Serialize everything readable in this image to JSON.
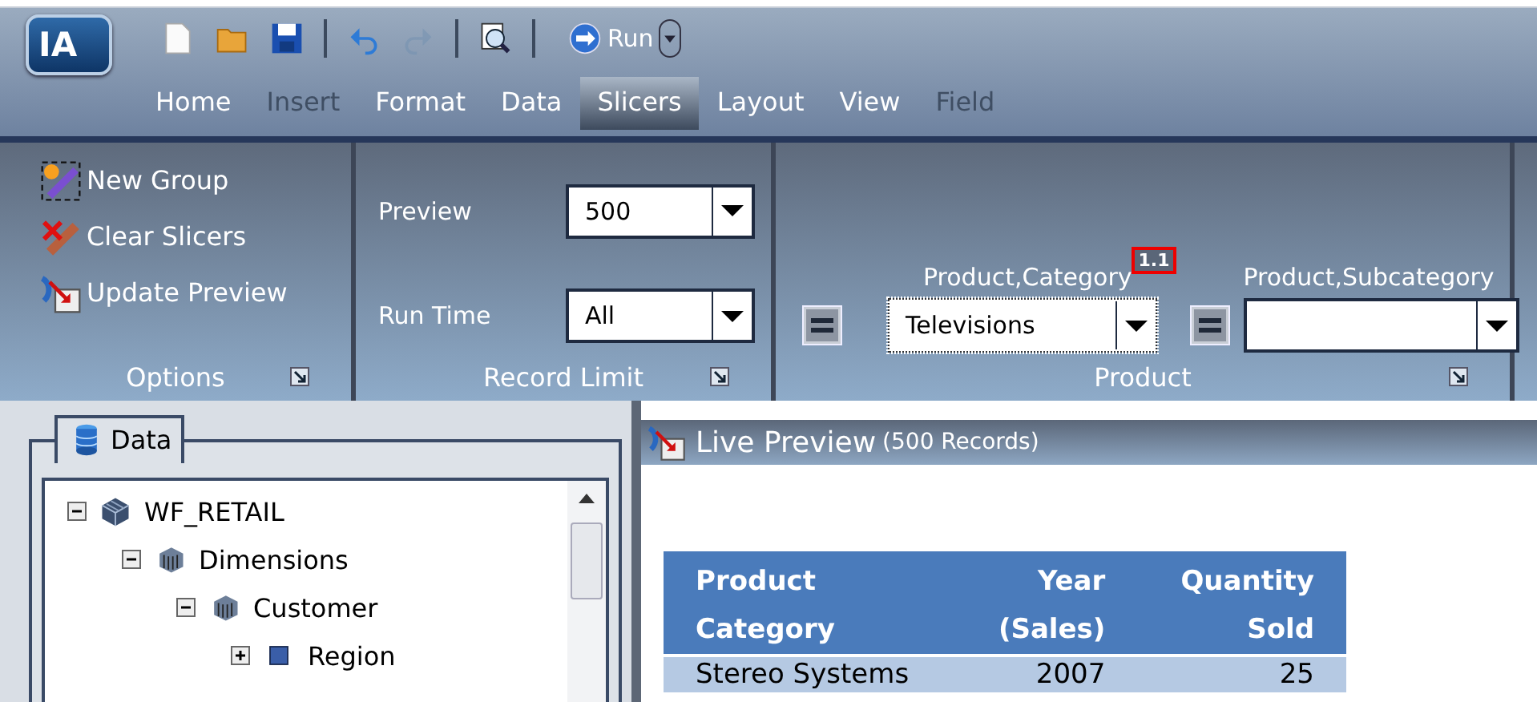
{
  "app": {
    "logo": "IA"
  },
  "quick_access": [
    {
      "kind": "new",
      "disabled": false
    },
    {
      "kind": "open",
      "disabled": false
    },
    {
      "kind": "save",
      "disabled": false
    },
    {
      "kind": "separator"
    },
    {
      "kind": "undo",
      "disabled": false
    },
    {
      "kind": "redo",
      "disabled": true
    },
    {
      "kind": "separator"
    },
    {
      "kind": "preview",
      "disabled": false
    },
    {
      "kind": "separator"
    }
  ],
  "run_button": {
    "label": "Run"
  },
  "tabs": [
    {
      "label": "Home",
      "selected": false,
      "disabled": false
    },
    {
      "label": "Insert",
      "selected": false,
      "disabled": true
    },
    {
      "label": "Format",
      "selected": false,
      "disabled": false
    },
    {
      "label": "Data",
      "selected": false,
      "disabled": false
    },
    {
      "label": "Slicers",
      "selected": true,
      "disabled": false
    },
    {
      "label": "Layout",
      "selected": false,
      "disabled": false
    },
    {
      "label": "View",
      "selected": false,
      "disabled": false
    },
    {
      "label": "Field",
      "selected": false,
      "disabled": true
    }
  ],
  "ribbon": {
    "options": {
      "title": "Options",
      "buttons": [
        {
          "kind": "new-group",
          "label": "New Group"
        },
        {
          "kind": "clear",
          "label": "Clear Slicers"
        },
        {
          "kind": "update",
          "label": "Update Preview"
        }
      ]
    },
    "record_limit": {
      "title": "Record Limit",
      "fields": [
        {
          "label": "Preview",
          "value": "500"
        },
        {
          "label": "Run Time",
          "value": "All"
        }
      ]
    },
    "product": {
      "title": "Product",
      "slicers": [
        {
          "label": "Product,Category",
          "badge": "1.1",
          "value": "Televisions",
          "focused": true
        },
        {
          "label": "Product,Subcategory",
          "focused": false
        }
      ]
    }
  },
  "data_panel": {
    "title": "Data",
    "tree": [
      {
        "label": "WF_RETAIL",
        "kind": "cube",
        "expanded": true,
        "children": [
          {
            "label": "Dimensions",
            "kind": "dimension",
            "expanded": true,
            "children": [
              {
                "label": "Customer",
                "kind": "dimension",
                "expanded": true,
                "children": [
                  {
                    "label": "Region",
                    "kind": "level",
                    "expanded": false
                  }
                ]
              }
            ]
          }
        ]
      }
    ]
  },
  "preview": {
    "title": "Live Preview",
    "subtitle": "(500 Records)",
    "table": {
      "columns": [
        {
          "lines": [
            "Product",
            "Category"
          ]
        },
        {
          "lines": [
            "Year",
            "(Sales)"
          ]
        },
        {
          "lines": [
            "Quantity",
            "Sold"
          ]
        }
      ],
      "rows": [
        [
          "Stereo Systems",
          "2007",
          "25"
        ]
      ]
    }
  }
}
